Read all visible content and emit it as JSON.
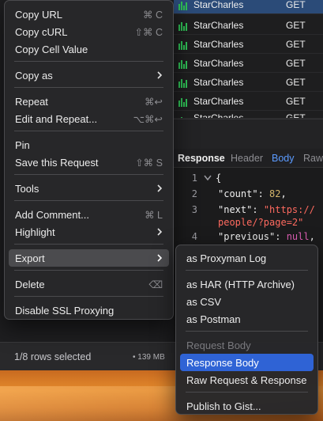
{
  "request_list": {
    "rows": [
      {
        "client": "StarCharles",
        "method": "GET"
      },
      {
        "client": "StarCharles",
        "method": "GET"
      },
      {
        "client": "StarCharles",
        "method": "GET"
      },
      {
        "client": "StarCharles",
        "method": "GET"
      },
      {
        "client": "StarCharles",
        "method": "GET"
      },
      {
        "client": "StarCharles",
        "method": "GET"
      },
      {
        "client": "StarCharles",
        "method": "GET"
      }
    ]
  },
  "response_panel": {
    "tabs": {
      "response": "Response",
      "header": "Header",
      "body": "Body",
      "raw": "Raw"
    },
    "code": {
      "ln1": "1",
      "line1": "{",
      "ln2": "2",
      "line2_key": "\"count\"",
      "line2_val": "82",
      "ln3": "3",
      "line3_key": "\"next\"",
      "line3_val": "\"https://",
      "line3b_val": "people/?page=2\"",
      "ln4": "4",
      "line4_key": "\"previous\"",
      "line4_val": "null"
    }
  },
  "status_bar": {
    "rows_selected": "1/8 rows selected",
    "size": "• 139 MB"
  },
  "context_menu": {
    "copy_url": "Copy URL",
    "copy_url_shortcut": "⌘ C",
    "copy_curl": "Copy cURL",
    "copy_curl_shortcut": "⇧⌘ C",
    "copy_cell_value": "Copy Cell Value",
    "copy_as": "Copy as",
    "repeat": "Repeat",
    "repeat_shortcut": "⌘↩",
    "edit_and_repeat": "Edit and Repeat...",
    "edit_and_repeat_shortcut": "⌥⌘↩",
    "pin": "Pin",
    "save_request": "Save this Request",
    "save_request_shortcut": "⇧⌘ S",
    "tools": "Tools",
    "add_comment": "Add Comment...",
    "add_comment_shortcut": "⌘ L",
    "highlight": "Highlight",
    "export": "Export",
    "delete": "Delete",
    "delete_shortcut": "⌫",
    "disable_ssl": "Disable SSL Proxying"
  },
  "export_submenu": {
    "proxyman_log": "as Proxyman Log",
    "har": "as HAR (HTTP Archive)",
    "csv": "as CSV",
    "postman": "as Postman",
    "request_body": "Request Body",
    "response_body": "Response Body",
    "raw_request_response": "Raw Request & Response",
    "publish_gist": "Publish to Gist..."
  },
  "colors": {
    "selection": "#2f63d5",
    "hover": "#4b4b4e",
    "chart_green": "#2fbf55"
  }
}
